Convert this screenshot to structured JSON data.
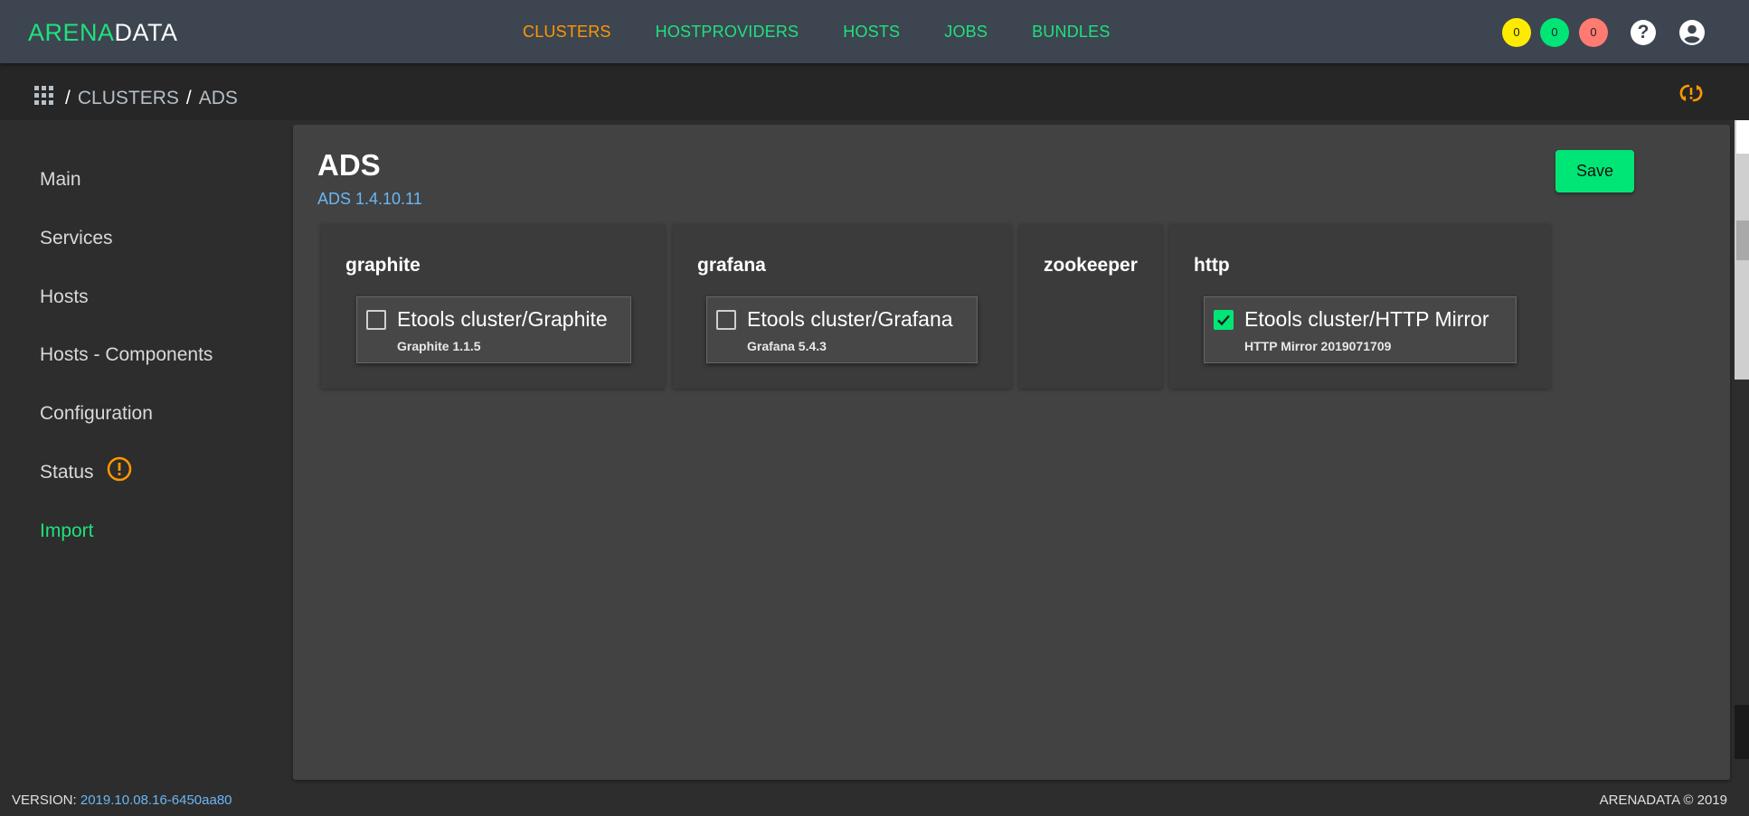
{
  "header": {
    "logo_part1": "ARENA",
    "logo_part2": "DATA",
    "nav": [
      "CLUSTERS",
      "HOSTPROVIDERS",
      "HOSTS",
      "JOBS",
      "BUNDLES"
    ],
    "active_nav": "CLUSTERS",
    "badges": [
      {
        "value": "0",
        "color": "#ffeb00"
      },
      {
        "value": "0",
        "color": "#00e676"
      },
      {
        "value": "0",
        "color": "#ff7a70"
      }
    ],
    "help_glyph": "?"
  },
  "breadcrumb": {
    "separator": "/",
    "items": [
      "CLUSTERS",
      "ADS"
    ]
  },
  "sidebar": {
    "items": [
      "Main",
      "Services",
      "Hosts",
      "Hosts - Components",
      "Configuration",
      "Status",
      "Import"
    ],
    "active": "Import"
  },
  "cluster": {
    "title": "ADS",
    "version": "ADS 1.4.10.11",
    "save_label": "Save"
  },
  "imports": [
    {
      "title": "graphite",
      "service": "Etools cluster/Graphite",
      "version": "Graphite 1.1.5",
      "checked": false
    },
    {
      "title": "grafana",
      "service": "Etools cluster/Grafana",
      "version": "Grafana 5.4.3",
      "checked": false
    },
    {
      "title": "zookeeper"
    },
    {
      "title": "http",
      "service": "Etools cluster/HTTP Mirror",
      "version": "HTTP Mirror 2019071709",
      "checked": true
    }
  ],
  "footer": {
    "version_label": "VERSION:",
    "version_value": "2019.10.08.16-6450aa80",
    "copyright": "ARENADATA © 2019"
  },
  "colors": {
    "accent": "#1ee27c",
    "active_nav": "#ff9800",
    "link": "#6bb6f5"
  }
}
